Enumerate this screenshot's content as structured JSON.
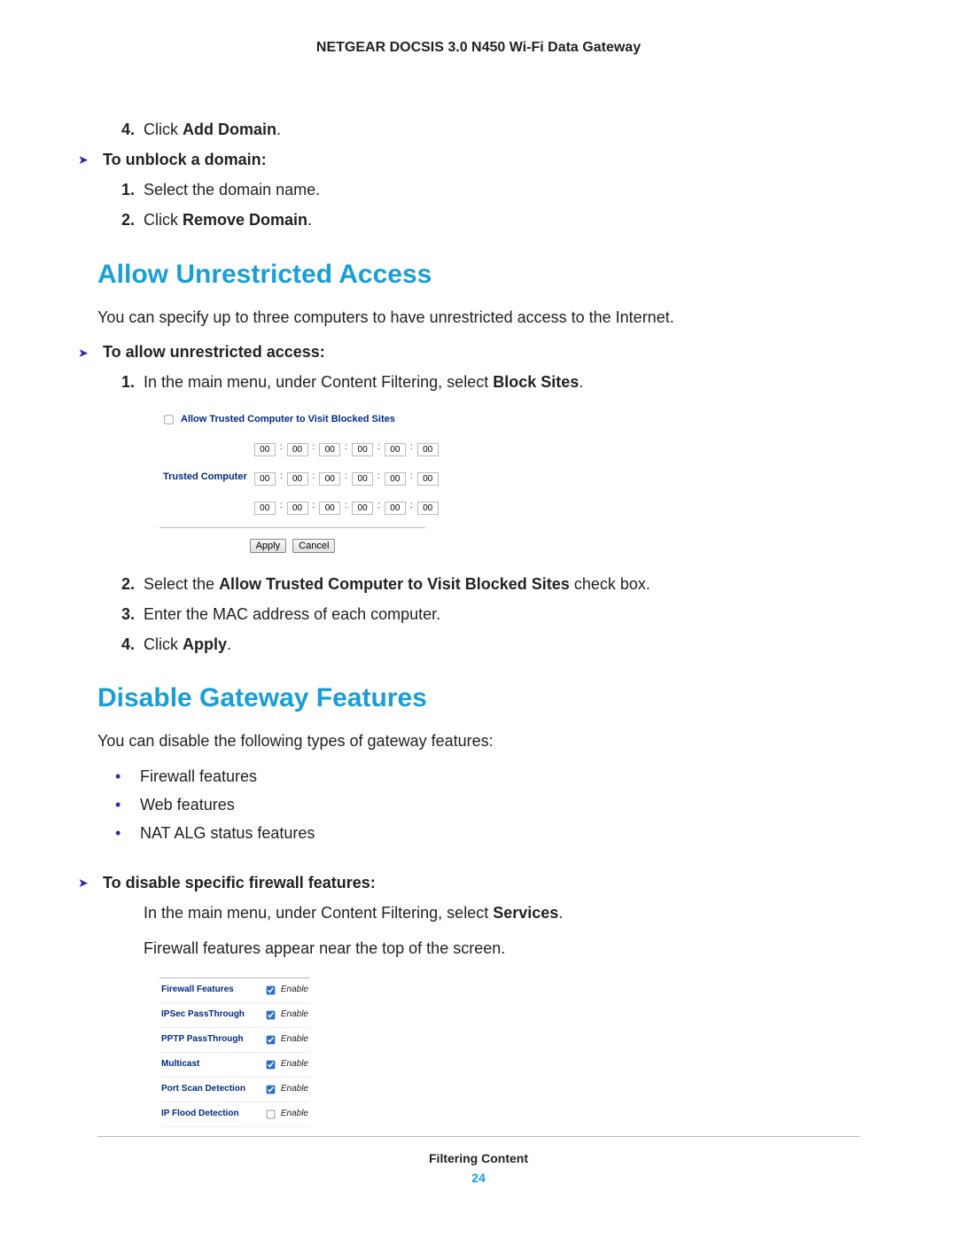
{
  "header": {
    "title": "NETGEAR DOCSIS 3.0 N450 Wi-Fi Data Gateway"
  },
  "footer": {
    "chapter": "Filtering Content",
    "page": "24"
  },
  "top_steps": {
    "s4_num": "4.",
    "s4_a": "Click ",
    "s4_b": "Add Domain",
    "s4_c": "."
  },
  "proc_unblock": {
    "head": "To unblock a domain:",
    "s1_num": "1.",
    "s1": "Select the domain name.",
    "s2_num": "2.",
    "s2_a": "Click ",
    "s2_b": "Remove Domain",
    "s2_c": "."
  },
  "h_allow": "Allow Unrestricted Access",
  "p_allow": "You can specify up to three computers to have unrestricted access to the Internet.",
  "proc_allow": {
    "head": "To allow unrestricted access:",
    "s1_num": "1.",
    "s1_a": "In the main menu, under Content Filtering, select ",
    "s1_b": "Block Sites",
    "s1_c": ".",
    "s2_num": "2.",
    "s2_a": "Select the ",
    "s2_b": "Allow Trusted Computer to Visit Blocked Sites",
    "s2_c": " check box.",
    "s3_num": "3.",
    "s3": "Enter the MAC address of each computer.",
    "s4_num": "4.",
    "s4_a": "Click ",
    "s4_b": "Apply",
    "s4_c": "."
  },
  "trusted_panel": {
    "head": "Allow Trusted Computer to Visit Blocked Sites",
    "row_label": "Trusted Computer",
    "cell": "00",
    "apply": "Apply",
    "cancel": "Cancel",
    "checked": false
  },
  "h_disable": "Disable Gateway Features",
  "p_disable": "You can disable the following types of gateway features:",
  "bullets": {
    "b1": "Firewall features",
    "b2": "Web features",
    "b3": "NAT ALG status features"
  },
  "proc_firewall": {
    "head": "To disable specific firewall features:",
    "p1_a": "In the main menu, under Content Filtering, select ",
    "p1_b": "Services",
    "p1_c": ".",
    "p2": "Firewall features appear near the top of the screen."
  },
  "fw_panel": {
    "enable_label": "Enable",
    "items": [
      {
        "label": "Firewall Features",
        "checked": true
      },
      {
        "label": "IPSec PassThrough",
        "checked": true
      },
      {
        "label": "PPTP PassThrough",
        "checked": true
      },
      {
        "label": "Multicast",
        "checked": true
      },
      {
        "label": "Port Scan Detection",
        "checked": true
      },
      {
        "label": "IP Flood Detection",
        "checked": false
      }
    ]
  }
}
